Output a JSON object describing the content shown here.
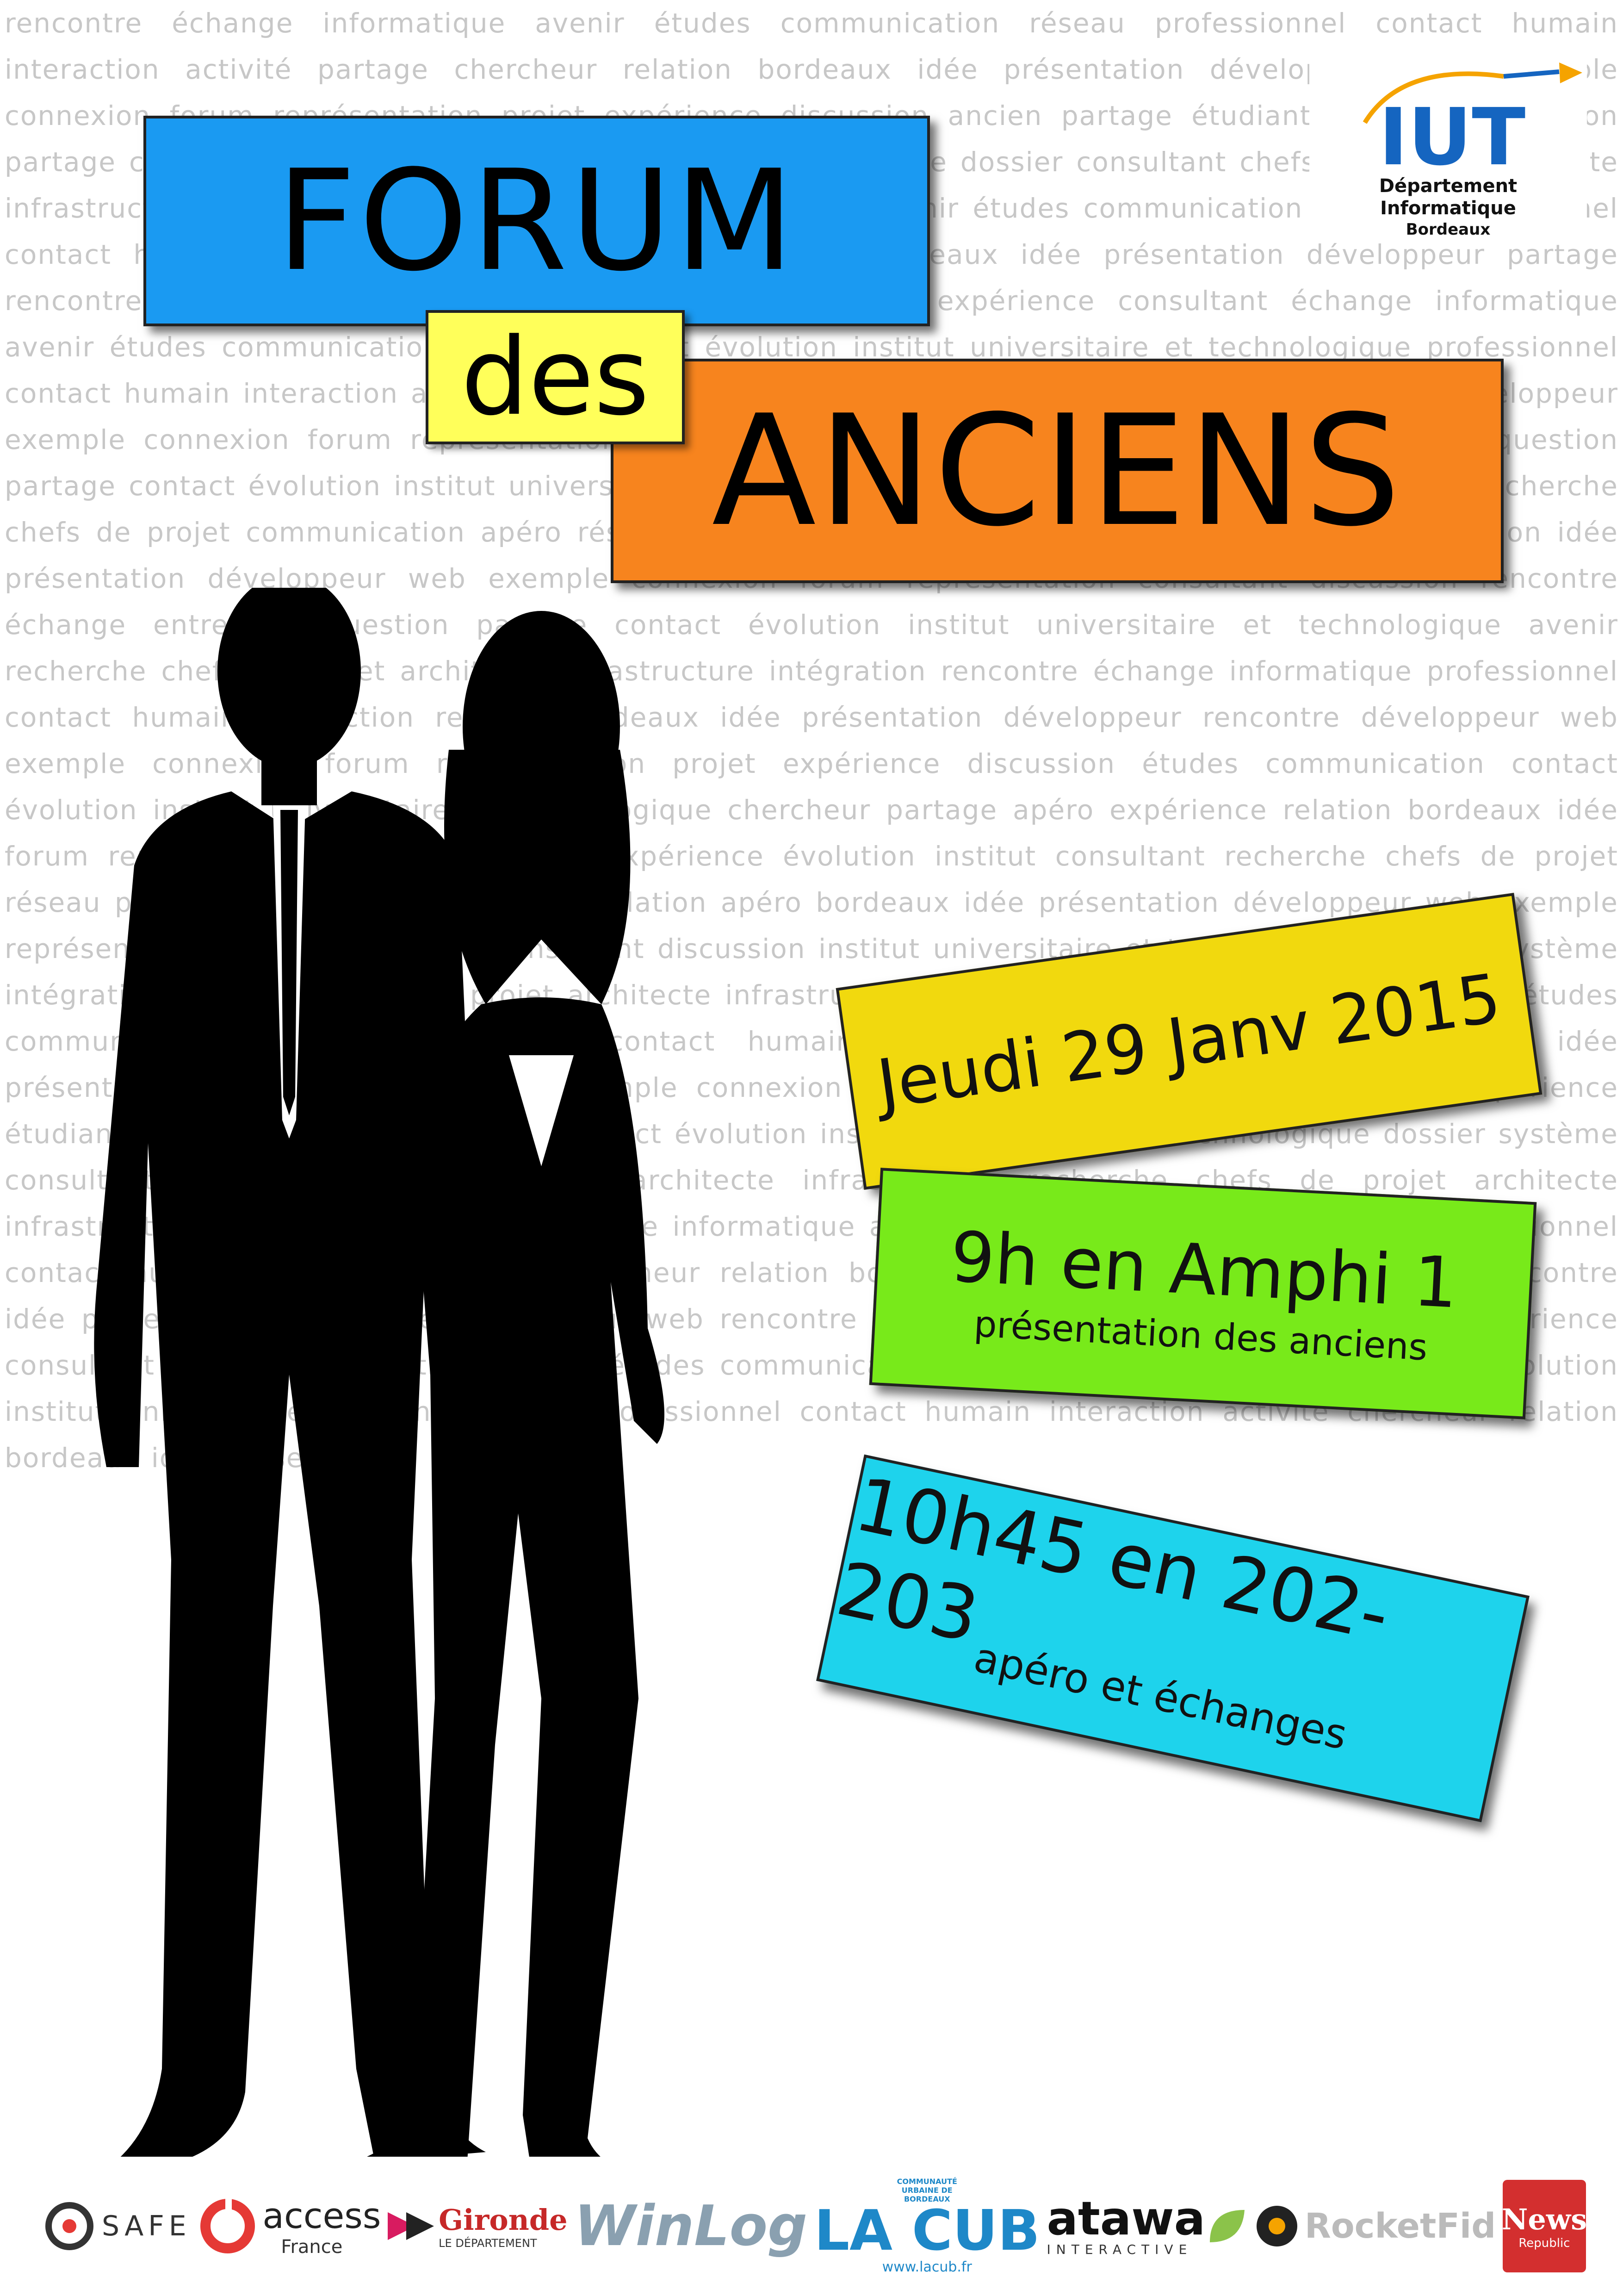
{
  "background_words": "rencontre échange informatique avenir études communication réseau professionnel contact humain interaction activité partage chercheur relation bordeaux idée présentation développeur web exemple connexion forum représentation projet expérience discussion ancien partage étudiant entreprise question partage contact évolution institut universitaire et technologique dossier consultant chefs de projet architecte infrastructure intégration rencontre échange informatique avenir études communication réseau professionnel contact humain interaction activité chercheur relation bordeaux idée présentation développeur partage rencontre bordeaux connexion forum représentation projet expérience consultant échange informatique avenir études communication partage contact évolution institut universitaire et technologique professionnel contact humain interaction activité chercheur apéro relation bordeaux partage idée présentation développeur exemple connexion forum représentation projet expérience discussion ancien étudiant entreprise question partage contact évolution institut universitaire et technologique dossier système rencontre contact recherche chefs de projet communication apéro réseau professionnel contact humain interaction activité relation idée présentation développeur web exemple connexion forum représentation consultant discussion rencontre échange entreprise question partage contact évolution institut universitaire et technologique avenir recherche chefs de projet architecte infrastructure intégration rencontre échange informatique professionnel contact humain interaction relation bordeaux idée présentation développeur rencontre développeur web exemple connexion forum représentation projet expérience discussion études communication contact évolution institut universitaire et technologique chercheur partage apéro expérience relation bordeaux idée forum représentation projet discussion expérience évolution institut consultant recherche chefs de projet réseau professionnel activité chercheur relation apéro bordeaux idée présentation développeur web exemple représentation projet expérience consultant discussion institut universitaire et technologique dossier système intégration recherche chefs de projet architecte infrastructure rencontre échange informatique avenir études communication réseau professionnel contact humain interaction chercheur relation bordeaux idée présentation développeur rencontre exemple connexion forum représentation projet discussion expérience étudiant entreprise question partage contact évolution institut universitaire et technologique dossier système consultant recherche chefs de projet architecte infrastructure recherche chefs de projet architecte infrastructure intégration rencontre échange informatique avenir études communication réseau professionnel contact humain interaction activité chercheur relation bordeaux idée présentation développeur rencontre idée présentation expérience développeur web rencontre connexion forum représentation projet expérience consultant échange informatique avenir études communication réseau partage expérience contact évolution institut universitaire et technologique professionnel contact humain interaction activité chercheur relation bordeaux idée présentation",
  "title": {
    "forum": "FORUM",
    "des": "des",
    "anciens": "ANCIENS"
  },
  "date_card": {
    "text": "Jeudi 29 Janv 2015"
  },
  "amphi_card": {
    "main": "9h en Amphi 1",
    "sub": "présentation des anciens"
  },
  "apero_card": {
    "main": "10h45 en 202-203",
    "sub": "apéro et échanges"
  },
  "iut_logo": {
    "name": "IUT",
    "line1": "Département",
    "line2": "Informatique",
    "line3": "Bordeaux",
    "accent_color": "#1565c0",
    "arrow_color": "#f5a300"
  },
  "sponsors": {
    "digisafe": "SAFE",
    "access": {
      "name": "access",
      "sub": "France"
    },
    "gironde": {
      "name": "Gironde",
      "sub": "LE DÉPARTEMENT"
    },
    "winlog": "WinLog",
    "lacub": {
      "name": "LA CUB",
      "top": "COMMUNAUTÉ URBAINE DE BORDEAUX",
      "url": "www.lacub.fr"
    },
    "atawa": {
      "name": "atawa",
      "sub": "INTERACTIVE"
    },
    "rocketfid": "RocketFid",
    "news": {
      "name": "News",
      "sub": "Republic"
    }
  },
  "colors": {
    "forum_block": "#1a9af2",
    "des_block": "#ffff5a",
    "anciens_block": "#f7841e",
    "date_card": "#f1d90e",
    "amphi_card": "#78ea1a",
    "apero_card": "#1ed3ec",
    "background_text": "#c7c7c7",
    "silhouette": "#000000"
  }
}
